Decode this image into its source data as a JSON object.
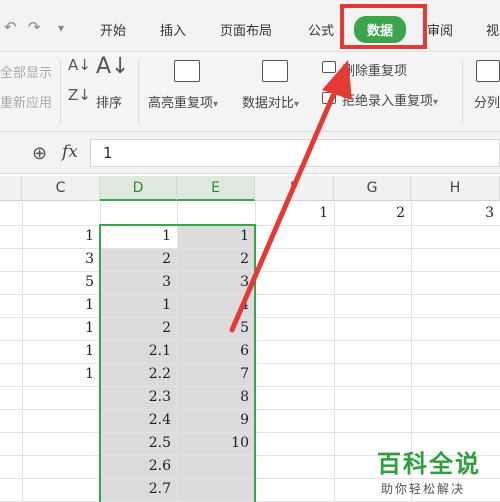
{
  "menubar": {
    "tabs": [
      {
        "label": "开始",
        "active": false
      },
      {
        "label": "插入",
        "active": false
      },
      {
        "label": "页面布局",
        "active": false
      },
      {
        "label": "公式",
        "active": false
      },
      {
        "label": "数据",
        "active": true
      },
      {
        "label": "审阅",
        "active": false
      },
      {
        "label": "视",
        "active": false
      }
    ]
  },
  "ribbon": {
    "show_all": "全部显示",
    "reapply": "重新应用",
    "sort": "排序",
    "highlight_dup": "高亮重复项",
    "data_compare": "数据对比",
    "remove_dup": "删除重复项",
    "reject_dup": "拒绝录入重复项",
    "split": "分列",
    "dropdown_glyph": "▾"
  },
  "formula_bar": {
    "fx_label": "fx",
    "value": "1"
  },
  "columns": [
    "C",
    "D",
    "E",
    "F",
    "G",
    "H"
  ],
  "rows": [
    {
      "C": "",
      "D": "",
      "E": "",
      "F": "1",
      "G": "2",
      "H": "3"
    },
    {
      "C": "1",
      "D": "1",
      "E": "1"
    },
    {
      "C": "3",
      "D": "2",
      "E": "2"
    },
    {
      "C": "5",
      "D": "3",
      "E": "3"
    },
    {
      "C": "1",
      "D": "1",
      "E": "4"
    },
    {
      "C": "1",
      "D": "2",
      "E": "5"
    },
    {
      "C": "1",
      "D": "2.1",
      "E": "6"
    },
    {
      "C": "1",
      "D": "2.2",
      "E": "7"
    },
    {
      "C": "",
      "D": "2.3",
      "E": "8"
    },
    {
      "C": "",
      "D": "2.4",
      "E": "9"
    },
    {
      "C": "",
      "D": "2.5",
      "E": "10"
    },
    {
      "C": "",
      "D": "2.6",
      "E": ""
    },
    {
      "C": "",
      "D": "2.7",
      "E": ""
    }
  ],
  "watermark": {
    "title": "百科全说",
    "subtitle": "助你轻松解决"
  },
  "colors": {
    "accent": "#3aa54a",
    "annotation_red": "#e53935",
    "selection_fill": "#dcdcdc"
  }
}
